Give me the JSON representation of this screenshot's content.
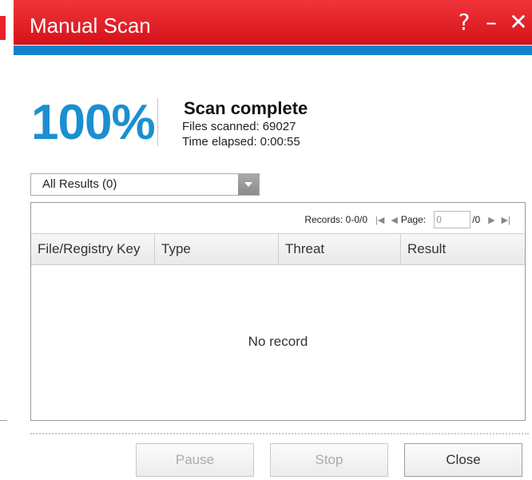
{
  "window": {
    "title": "Manual Scan",
    "help_glyph": "?",
    "minimize_glyph": "–",
    "close_glyph": "✕"
  },
  "scan": {
    "percent": "100%",
    "status": "Scan complete",
    "files_label": "Files scanned:",
    "files_value": "69027",
    "time_label": "Time elapsed:",
    "time_value": "0:00:55"
  },
  "filter": {
    "selected": "All Results (0)"
  },
  "pager": {
    "records_label": "Records: 0-0/0",
    "page_label": "Page:",
    "page_value": "0",
    "page_total": "/0"
  },
  "table": {
    "columns": [
      "File/Registry Key",
      "Type",
      "Threat",
      "Result"
    ],
    "empty_text": "No record"
  },
  "buttons": {
    "pause": "Pause",
    "stop": "Stop",
    "close": "Close"
  },
  "colors": {
    "title_red": "#e01a22",
    "accent_blue": "#1182c8",
    "percent_blue": "#1a8fd1"
  }
}
